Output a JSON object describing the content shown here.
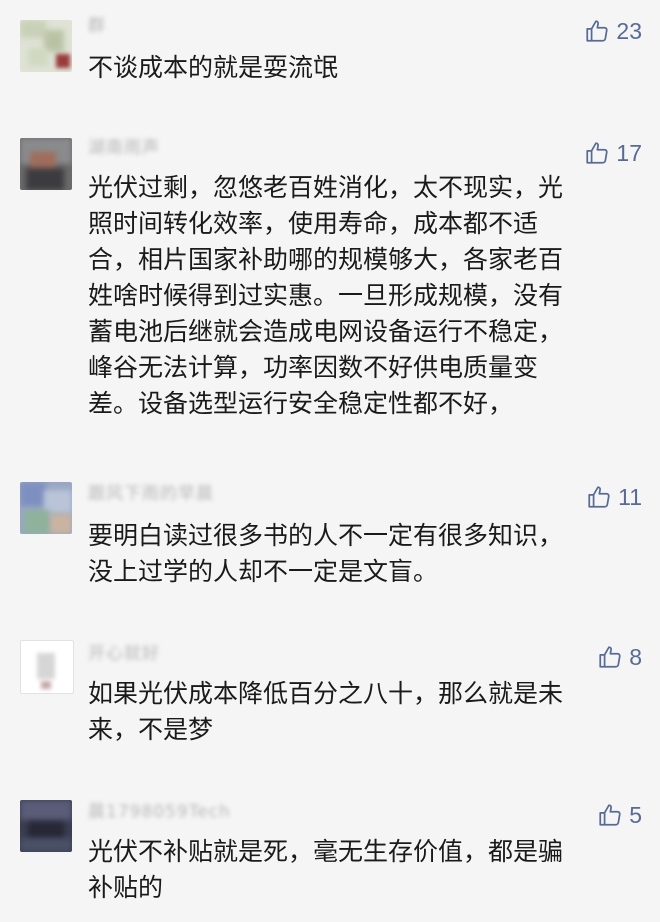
{
  "comments": [
    {
      "nickname": "群",
      "likes": "23",
      "lines": [
        "不谈成本的就是耍流氓"
      ]
    },
    {
      "nickname": "湖南雨声",
      "likes": "17",
      "lines": [
        "光伏过剩，忽悠老百姓消化，太不现实，光",
        "照时间转化效率，使用寿命，成本都不适",
        "合，相片国家补助哪的规模够大，各家老百",
        "姓啥时候得到过实惠。一旦形成规模，没有",
        "蓄电池后继就会造成电网设备运行不稳定，",
        "峰谷无法计算，功率因数不好供电质量变",
        "差。设备选型运行安全稳定性都不好，"
      ]
    },
    {
      "nickname": "跟风下雨的早晨",
      "likes": "11",
      "lines": [
        "要明白读过很多书的人不一定有很多知识，",
        "没上过学的人却不一定是文盲。"
      ]
    },
    {
      "nickname": "开心就好",
      "likes": "8",
      "lines": [
        "如果光伏成本降低百分之八十，那么就是未",
        "来，不是梦"
      ]
    },
    {
      "nickname": "晨1798059Tech",
      "likes": "5",
      "lines": [
        "光伏不补贴就是死，毫无生存价值，都是骗",
        "补贴的"
      ]
    }
  ],
  "icons": {
    "like": "thumbs-up-icon"
  },
  "colors": {
    "background": "#f5f5f5",
    "text": "#1a1a1a",
    "like_accent": "#576b95",
    "nickname": "#b7b7b7"
  }
}
